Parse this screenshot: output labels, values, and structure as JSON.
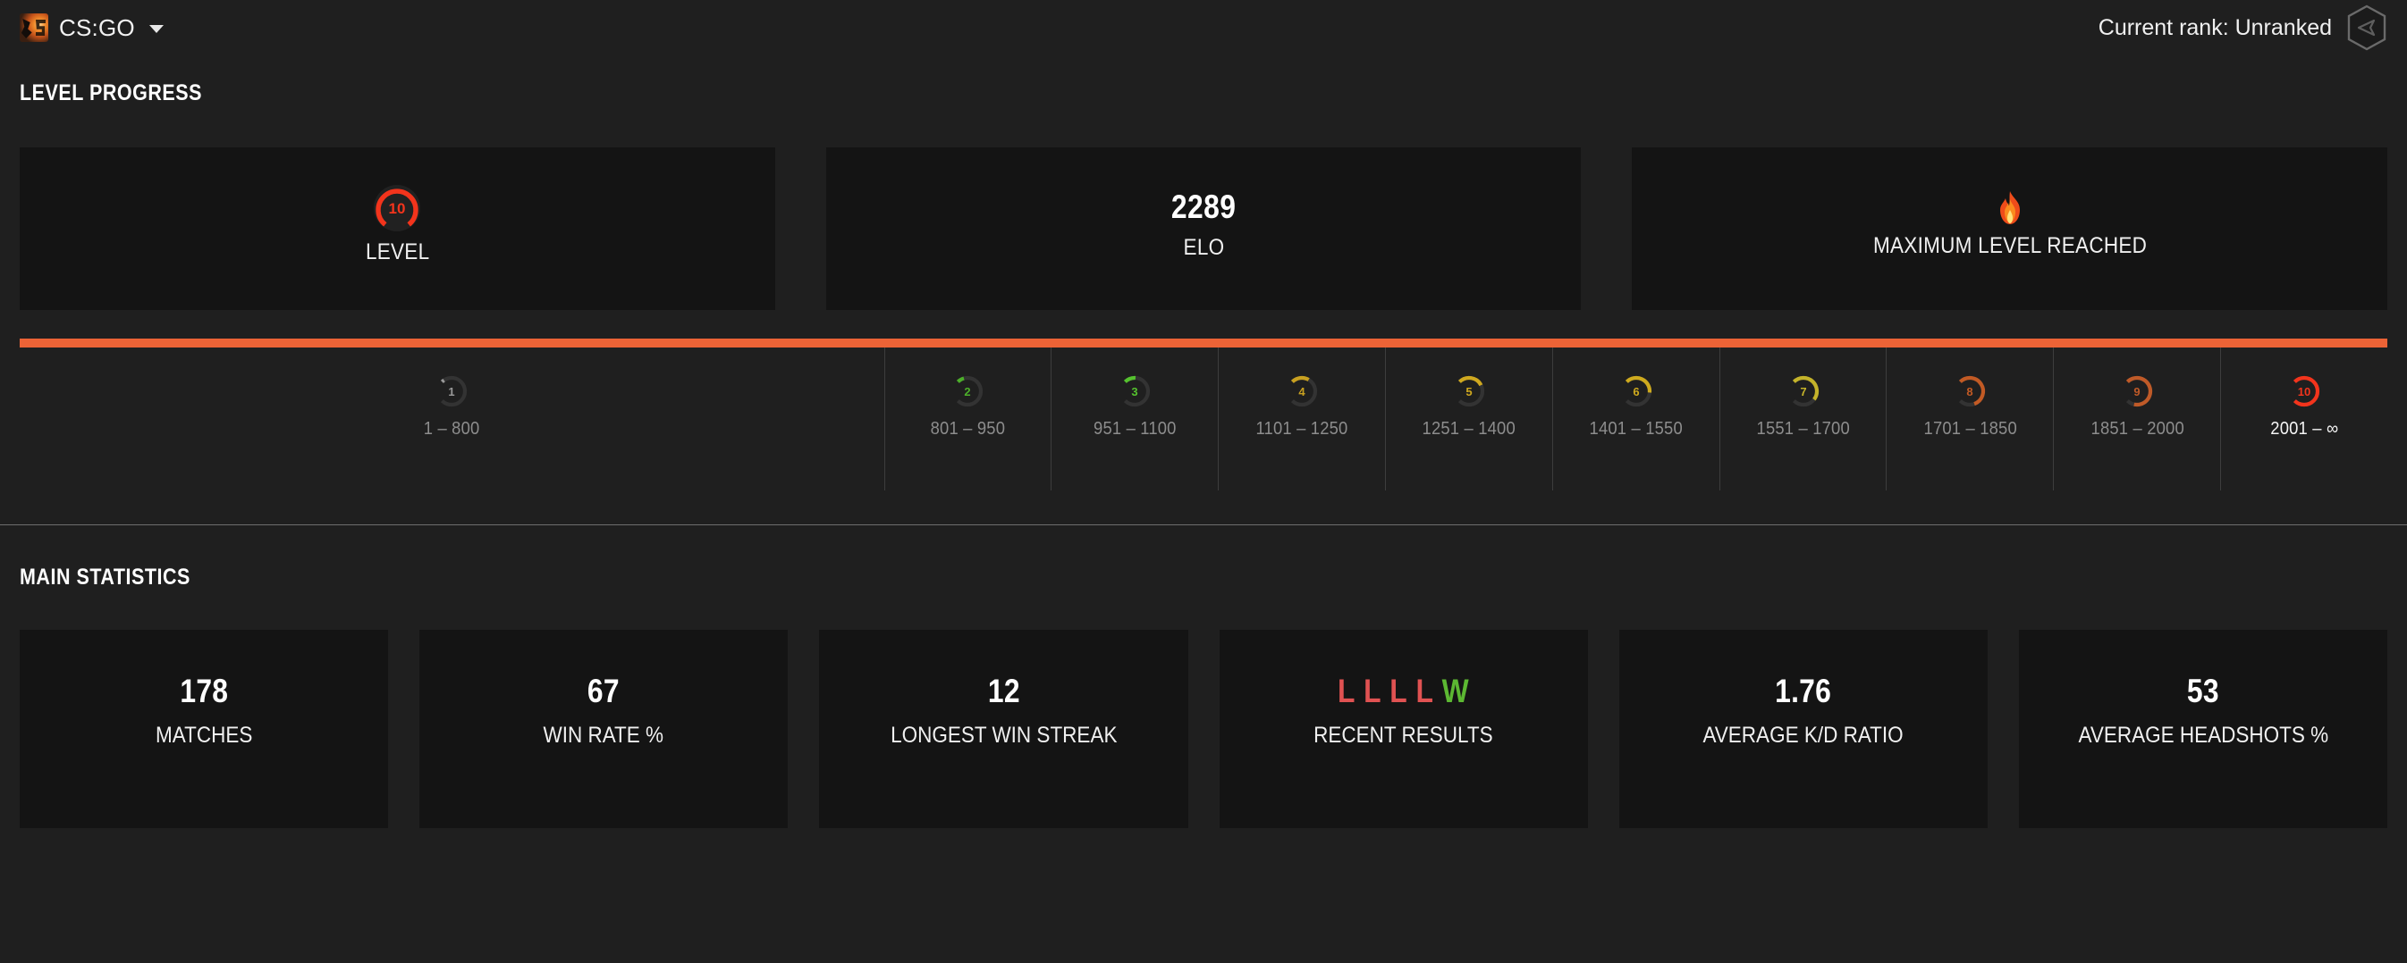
{
  "topbar": {
    "game_label": "CS:GO",
    "game_icon": "csgo-thumbnail",
    "dropdown_icon": "chevron-down-icon",
    "rank_text": "Current rank: Unranked",
    "rank_icon": "hexagon-rank-icon"
  },
  "level_progress": {
    "section_title": "LEVEL PROGRESS",
    "cards": [
      {
        "type": "gauge",
        "value": "10",
        "label": "LEVEL",
        "icon": "level-gauge-icon",
        "color": "#f3341c"
      },
      {
        "type": "number",
        "value": "2289",
        "label": "ELO",
        "icon": ""
      },
      {
        "type": "emoji",
        "value": "🔥",
        "label": "MAXIMUM LEVEL REACHED",
        "icon": "flame-icon"
      }
    ],
    "progress": {
      "percent": 100,
      "fill_color": "#ec6336",
      "track_color": "#3a3a3a"
    },
    "levels": [
      {
        "level": "1",
        "range": "1 – 800",
        "color": "#9a9a9a",
        "pct": 4,
        "current": false
      },
      {
        "level": "2",
        "range": "801 – 950",
        "color": "#4caf2a",
        "pct": 11,
        "current": false
      },
      {
        "level": "3",
        "range": "951 – 1100",
        "color": "#55c22e",
        "pct": 18,
        "current": false
      },
      {
        "level": "4",
        "range": "1101 – 1250",
        "color": "#c8a020",
        "pct": 28,
        "current": false
      },
      {
        "level": "5",
        "range": "1251 – 1400",
        "color": "#cfa81f",
        "pct": 40,
        "current": false
      },
      {
        "level": "6",
        "range": "1401 – 1550",
        "color": "#ceaa1e",
        "pct": 52,
        "current": false
      },
      {
        "level": "7",
        "range": "1551 – 1700",
        "color": "#c4b32a",
        "pct": 64,
        "current": false
      },
      {
        "level": "8",
        "range": "1701 – 1850",
        "color": "#c25a24",
        "pct": 76,
        "current": false
      },
      {
        "level": "9",
        "range": "1851 – 2000",
        "color": "#bf5a28",
        "pct": 88,
        "current": false
      },
      {
        "level": "10",
        "range": "2001 – ∞",
        "color": "#f3341c",
        "pct": 100,
        "current": true
      }
    ]
  },
  "main_statistics": {
    "section_title": "MAIN STATISTICS",
    "cards": [
      {
        "value": "178",
        "label": "MATCHES"
      },
      {
        "value": "67",
        "label": "WIN RATE %"
      },
      {
        "value": "12",
        "label": "LONGEST WIN STREAK"
      },
      {
        "value": "",
        "label": "RECENT RESULTS",
        "results": [
          "L",
          "L",
          "L",
          "L",
          "W"
        ]
      },
      {
        "value": "1.76",
        "label": "AVERAGE K/D RATIO"
      },
      {
        "value": "53",
        "label": "AVERAGE HEADSHOTS %"
      }
    ]
  },
  "colors": {
    "page_bg": "#1f1f1f",
    "card_bg": "#141414",
    "accent_orange": "#ec6336",
    "win_green": "#5cb832",
    "loss_red": "#e05252",
    "muted_text": "#8d8d8d"
  }
}
